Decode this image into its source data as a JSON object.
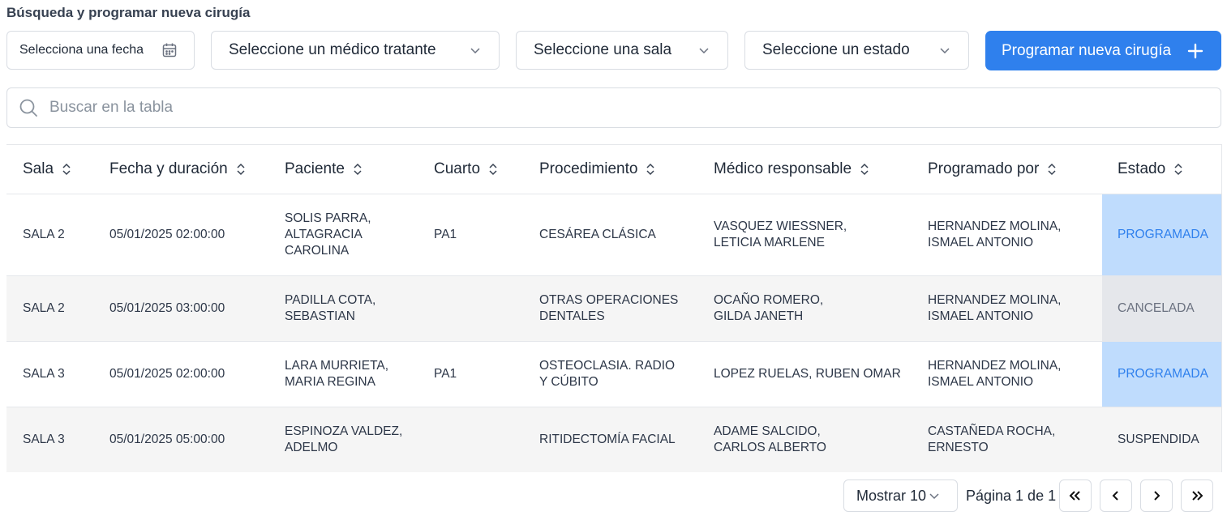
{
  "page": {
    "title": "Búsqueda y programar nueva cirugía"
  },
  "filters": {
    "date_placeholder": "Selecciona una fecha",
    "doctor_placeholder": "Seleccione un médico tratante",
    "room_placeholder": "Seleccione una sala",
    "status_placeholder": "Seleccione un estado",
    "new_button": "Programar nueva cirugía"
  },
  "search": {
    "placeholder": "Buscar en la tabla"
  },
  "table": {
    "headers": [
      "Sala",
      "Fecha y duración",
      "Paciente",
      "Cuarto",
      "Procedimiento",
      "Médico responsable",
      "Programado por",
      "Estado"
    ],
    "rows": [
      {
        "sala": "SALA 2",
        "fecha": "05/01/2025 02:00:00",
        "paciente": "SOLIS PARRA,\nALTAGRACIA\nCAROLINA",
        "cuarto": "PA1",
        "procedimiento": "CESÁREA CLÁSICA",
        "medico": "VASQUEZ WIESSNER,\nLETICIA MARLENE",
        "programado": "HERNANDEZ MOLINA,\nISMAEL ANTONIO",
        "estado": "PROGRAMADA"
      },
      {
        "sala": "SALA 2",
        "fecha": "05/01/2025 03:00:00",
        "paciente": "PADILLA COTA,\nSEBASTIAN",
        "cuarto": "",
        "procedimiento": "OTRAS OPERACIONES\nDENTALES",
        "medico": "OCAÑO ROMERO,\nGILDA JANETH",
        "programado": "HERNANDEZ MOLINA,\nISMAEL ANTONIO",
        "estado": "CANCELADA"
      },
      {
        "sala": "SALA 3",
        "fecha": "05/01/2025 02:00:00",
        "paciente": "LARA MURRIETA,\nMARIA REGINA",
        "cuarto": "PA1",
        "procedimiento": "OSTEOCLASIA. RADIO\nY CÚBITO",
        "medico": "LOPEZ RUELAS, RUBEN OMAR",
        "programado": "HERNANDEZ MOLINA,\nISMAEL ANTONIO",
        "estado": "PROGRAMADA"
      },
      {
        "sala": "SALA 3",
        "fecha": "05/01/2025 05:00:00",
        "paciente": "ESPINOZA VALDEZ,\nADELMO",
        "cuarto": "",
        "procedimiento": "RITIDECTOMÍA FACIAL",
        "medico": "ADAME SALCIDO,\nCARLOS ALBERTO",
        "programado": "CASTAÑEDA ROCHA,\nERNESTO",
        "estado": "SUSPENDIDA"
      }
    ]
  },
  "pagination": {
    "show_label": "Mostrar 10",
    "page_info": "Página 1 de 1"
  },
  "colors": {
    "accent": "#2f80ed",
    "programada_bg": "#bfdcfd",
    "cancelada_bg": "#e5e7eb"
  }
}
